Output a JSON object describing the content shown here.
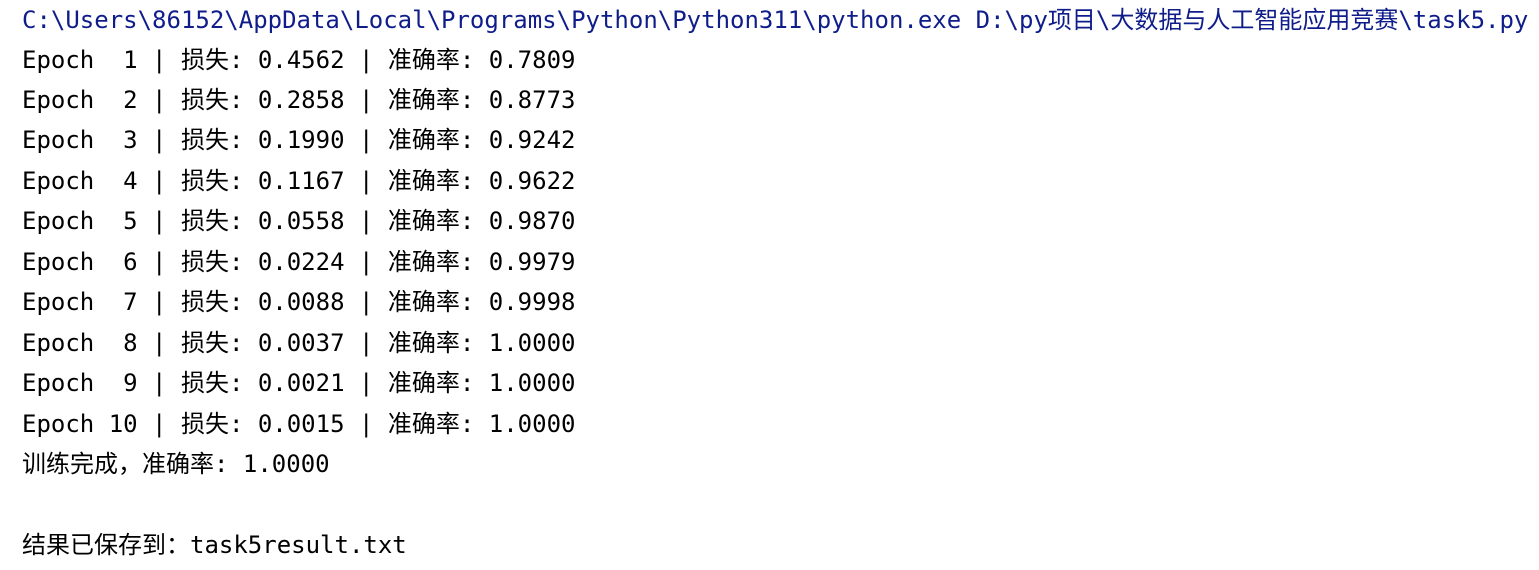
{
  "console": {
    "command": "C:\\Users\\86152\\AppData\\Local\\Programs\\Python\\Python311\\python.exe D:\\py项目\\大数据与人工智能应用竞赛\\task5.py",
    "lines": [
      "Epoch  1 | 损失: 0.4562 | 准确率: 0.7809",
      "Epoch  2 | 损失: 0.2858 | 准确率: 0.8773",
      "Epoch  3 | 损失: 0.1990 | 准确率: 0.9242",
      "Epoch  4 | 损失: 0.1167 | 准确率: 0.9622",
      "Epoch  5 | 损失: 0.0558 | 准确率: 0.9870",
      "Epoch  6 | 损失: 0.0224 | 准确率: 0.9979",
      "Epoch  7 | 损失: 0.0088 | 准确率: 0.9998",
      "Epoch  8 | 损失: 0.0037 | 准确率: 1.0000",
      "Epoch  9 | 损失: 0.0021 | 准确率: 1.0000",
      "Epoch 10 | 损失: 0.0015 | 准确率: 1.0000"
    ],
    "summary": "训练完成，准确率: 1.0000",
    "saved": "结果已保存到：task5result.txt"
  },
  "colors": {
    "command": "#0f1d8a",
    "text": "#000000",
    "background": "#ffffff"
  }
}
